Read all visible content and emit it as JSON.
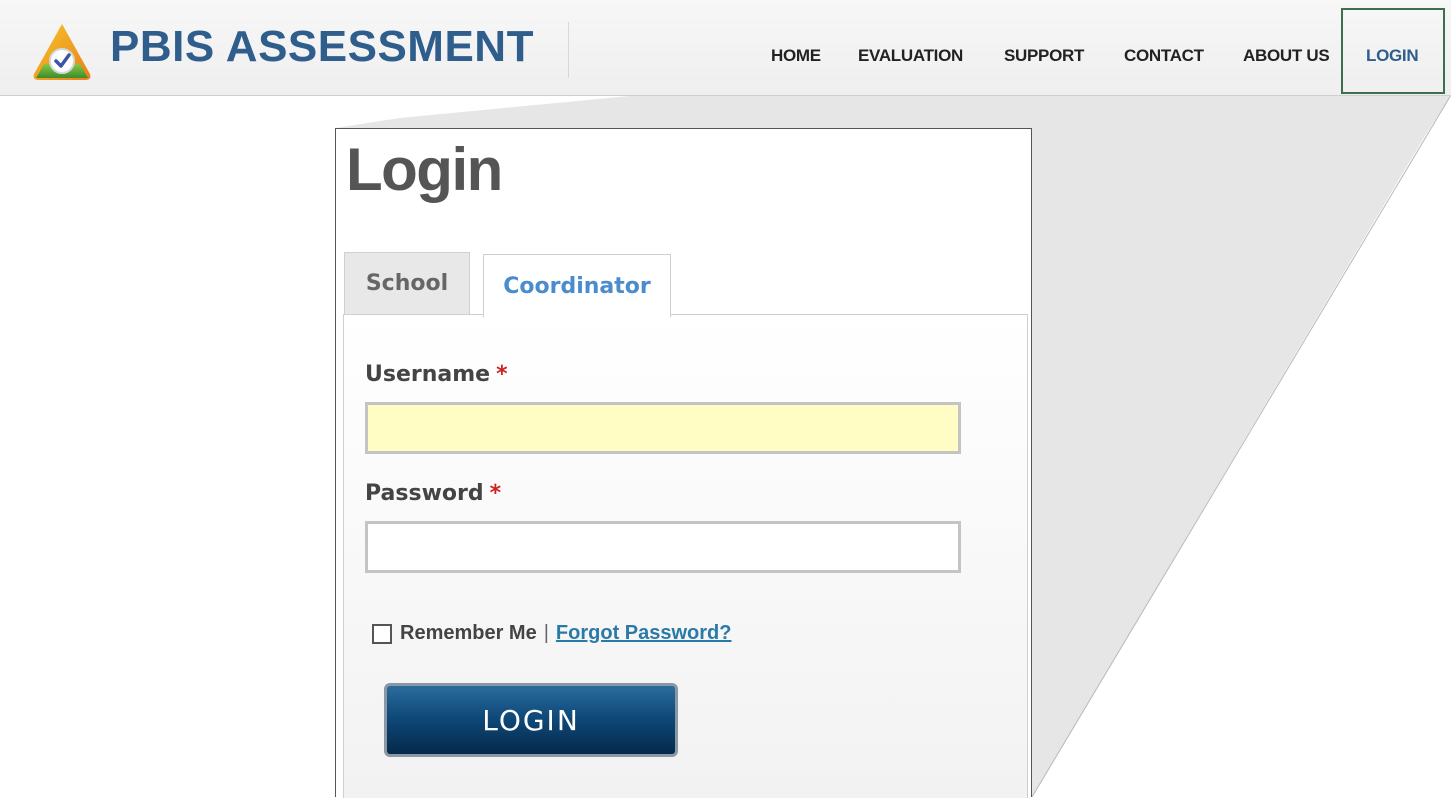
{
  "brand": {
    "title": "PBIS ASSESSMENT",
    "icon": "triangle-check-logo-icon"
  },
  "nav": {
    "items": [
      "HOME",
      "EVALUATION",
      "SUPPORT",
      "CONTACT",
      "ABOUT US",
      "LOGIN"
    ],
    "active": "LOGIN"
  },
  "login": {
    "title": "Login",
    "tabs": [
      "School",
      "Coordinator"
    ],
    "active_tab": "Coordinator",
    "username_label": "Username",
    "password_label": "Password",
    "required_marker": "*",
    "username_value": "",
    "password_value": "",
    "remember_label": "Remember Me",
    "separator": "|",
    "forgot_link": "Forgot Password?",
    "submit_label": "LOGIN"
  },
  "colors": {
    "brand": "#2f5d8c",
    "tab_active": "#4a8ccc",
    "username_bg": "#fffdc4",
    "required": "#cc2222",
    "link": "#2a7aa8",
    "button": "#0f4a7a"
  }
}
